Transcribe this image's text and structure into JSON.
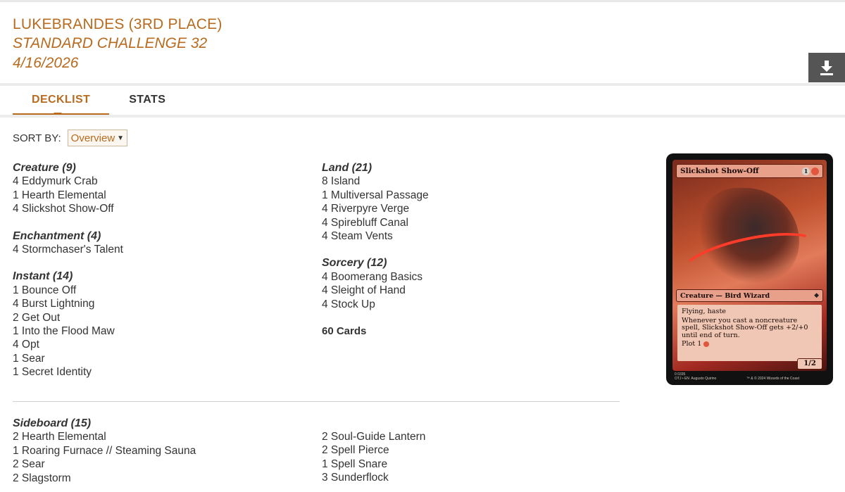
{
  "header": {
    "player": "LUKEBRANDES (3RD PLACE)",
    "event": "STANDARD CHALLENGE 32",
    "date": "4/16/2026"
  },
  "download_icon": "download-icon",
  "tabs": [
    {
      "label": "DECKLIST",
      "active": true
    },
    {
      "label": "STATS",
      "active": false
    }
  ],
  "sort": {
    "label": "SORT BY:",
    "selected": "Overview"
  },
  "main_left": [
    {
      "title": "Creature (9)",
      "cards": [
        "4 Eddymurk Crab",
        "1 Hearth Elemental",
        "4 Slickshot Show-Off"
      ]
    },
    {
      "title": "Enchantment (4)",
      "cards": [
        "4 Stormchaser's Talent"
      ]
    },
    {
      "title": "Instant (14)",
      "cards": [
        "1 Bounce Off",
        "4 Burst Lightning",
        "2 Get Out",
        "1 Into the Flood Maw",
        "4 Opt",
        "1 Sear",
        "1 Secret Identity"
      ]
    }
  ],
  "main_right": [
    {
      "title": "Land (21)",
      "cards": [
        "8 Island",
        "1 Multiversal Passage",
        "4 Riverpyre Verge",
        "4 Spirebluff Canal",
        "4 Steam Vents"
      ]
    },
    {
      "title": "Sorcery (12)",
      "cards": [
        "4 Boomerang Basics",
        "4 Sleight of Hand",
        "4 Stock Up"
      ]
    }
  ],
  "total": "60 Cards",
  "sideboard": {
    "title": "Sideboard (15)",
    "left": [
      "2 Hearth Elemental",
      "1 Roaring Furnace // Steaming Sauna",
      "2 Sear",
      "2 Slagstorm"
    ],
    "right": [
      "2 Soul-Guide Lantern",
      "2 Spell Pierce",
      "1 Spell Snare",
      "3 Sunderflock"
    ]
  },
  "preview_card": {
    "name": "Slickshot Show-Off",
    "mana_generic": "1",
    "type_line": "Creature — Bird Wizard",
    "ability1": "Flying, haste",
    "ability2": "Whenever you cast a noncreature spell, Slickshot Show-Off gets +2/+0 until end of turn.",
    "plot": "Plot 1",
    "pt": "1/2",
    "footer_left": "0 0335\nOTJ • EN  Augusto Quirino",
    "footer_right": "™ & © 2024 Wizards of the Coast",
    "colors": {
      "frame": "#e8a08b",
      "text_box": "#f0c7b5",
      "red_mana": "#e2563e"
    }
  },
  "colors": {
    "accent": "#b86a1e",
    "download_bg": "#555555"
  }
}
